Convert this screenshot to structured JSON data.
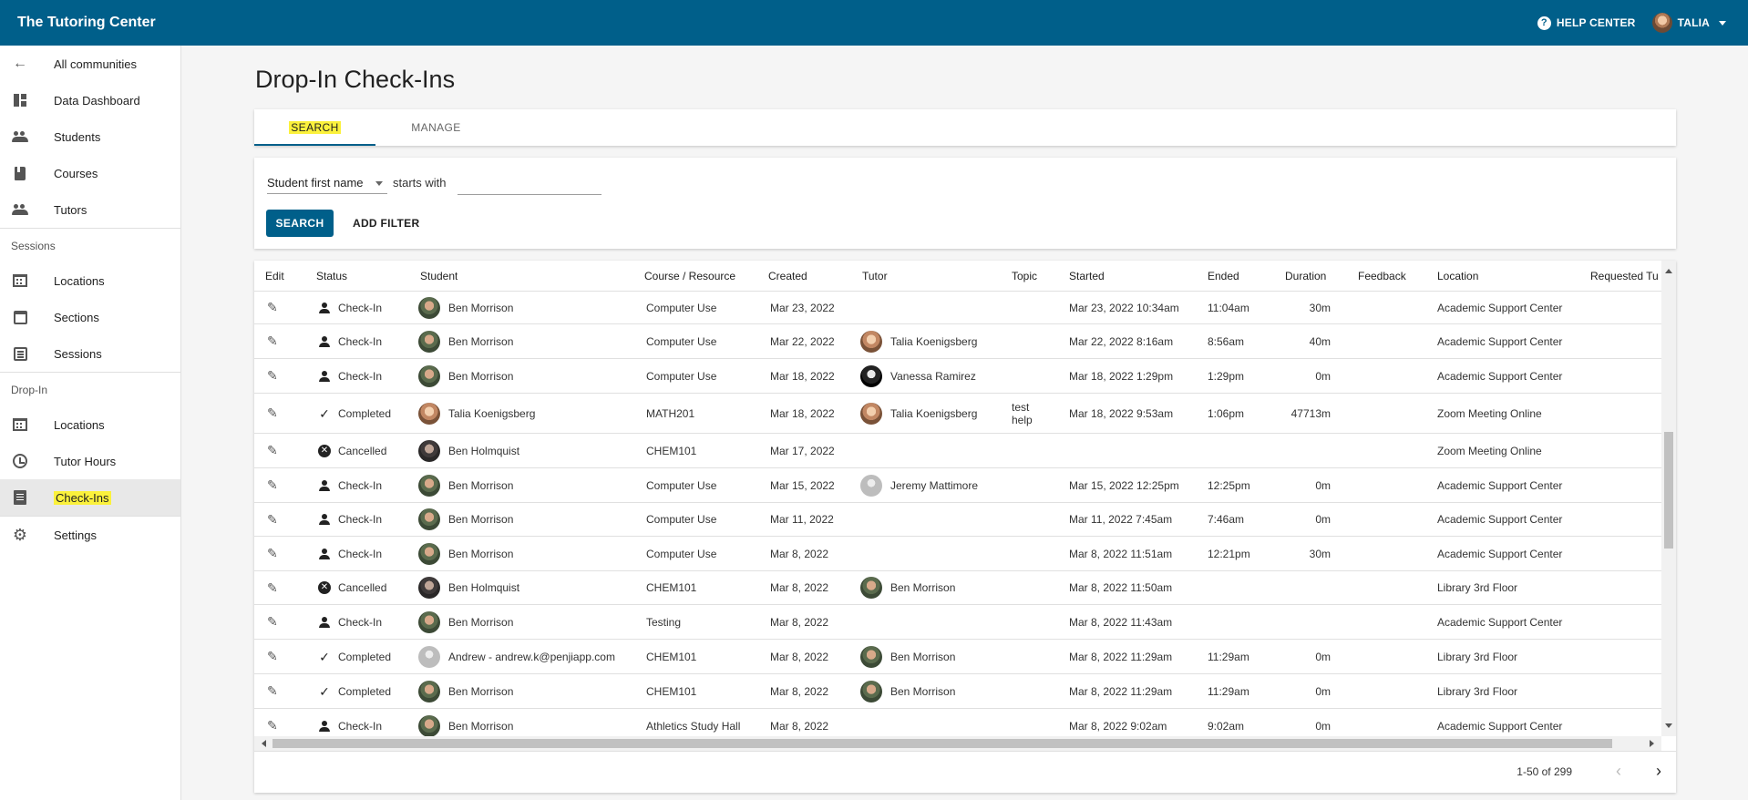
{
  "app": {
    "title": "The Tutoring Center",
    "help_label": "HELP CENTER",
    "user_name": "TALIA"
  },
  "sidebar": {
    "back": "All communities",
    "main_items": [
      "Data Dashboard",
      "Students",
      "Courses",
      "Tutors"
    ],
    "sessions_label": "Sessions",
    "sessions_items": [
      "Locations",
      "Sections",
      "Sessions"
    ],
    "dropin_label": "Drop-In",
    "dropin_items": [
      "Locations",
      "Tutor Hours",
      "Check-Ins"
    ],
    "settings": "Settings"
  },
  "page": {
    "title": "Drop-In Check-Ins"
  },
  "tabs": [
    {
      "label": "SEARCH"
    },
    {
      "label": "MANAGE"
    }
  ],
  "filter": {
    "field": "Student first name",
    "operator": "starts with",
    "value": "",
    "search_label": "SEARCH",
    "add_filter_label": "ADD FILTER"
  },
  "table": {
    "columns": [
      "Edit",
      "Status",
      "Student",
      "Course / Resource",
      "Created",
      "Tutor",
      "Topic",
      "Started",
      "Ended",
      "Duration",
      "Feedback",
      "Location",
      "Requested Tu"
    ],
    "rows": [
      {
        "status": "Check-In",
        "status_icon": "person-icon",
        "student": "Ben Morrison",
        "student_avatar": "ben",
        "course": "Computer Use",
        "created": "Mar 23, 2022",
        "tutor": "",
        "tutor_avatar": "",
        "topic": "",
        "started": "Mar 23, 2022 10:34am",
        "ended": "11:04am",
        "duration": "30m",
        "feedback": "",
        "location": "Academic Support Center"
      },
      {
        "status": "Check-In",
        "status_icon": "person-icon",
        "student": "Ben Morrison",
        "student_avatar": "ben",
        "course": "Computer Use",
        "created": "Mar 22, 2022",
        "tutor": "Talia Koenigsberg",
        "tutor_avatar": "talia",
        "topic": "",
        "started": "Mar 22, 2022 8:16am",
        "ended": "8:56am",
        "duration": "40m",
        "feedback": "",
        "location": "Academic Support Center"
      },
      {
        "status": "Check-In",
        "status_icon": "person-icon",
        "student": "Ben Morrison",
        "student_avatar": "ben",
        "course": "Computer Use",
        "created": "Mar 18, 2022",
        "tutor": "Vanessa Ramirez",
        "tutor_avatar": "vanessa",
        "topic": "",
        "started": "Mar 18, 2022 1:29pm",
        "ended": "1:29pm",
        "duration": "0m",
        "feedback": "",
        "location": "Academic Support Center"
      },
      {
        "status": "Completed",
        "status_icon": "check-icon",
        "student": "Talia Koenigsberg",
        "student_avatar": "talia",
        "course": "MATH201",
        "created": "Mar 18, 2022",
        "tutor": "Talia Koenigsberg",
        "tutor_avatar": "talia",
        "topic": "test help",
        "started": "Mar 18, 2022 9:53am",
        "ended": "1:06pm",
        "duration": "47713m",
        "feedback": "",
        "location": "Zoom Meeting Online"
      },
      {
        "status": "Cancelled",
        "status_icon": "cancel-icon",
        "student": "Ben Holmquist",
        "student_avatar": "holm",
        "course": "CHEM101",
        "created": "Mar 17, 2022",
        "tutor": "",
        "tutor_avatar": "",
        "topic": "",
        "started": "",
        "ended": "",
        "duration": "",
        "feedback": "",
        "location": "Zoom Meeting Online"
      },
      {
        "status": "Check-In",
        "status_icon": "person-icon",
        "student": "Ben Morrison",
        "student_avatar": "ben",
        "course": "Computer Use",
        "created": "Mar 15, 2022",
        "tutor": "Jeremy Mattimore",
        "tutor_avatar": "blank",
        "topic": "",
        "started": "Mar 15, 2022 12:25pm",
        "ended": "12:25pm",
        "duration": "0m",
        "feedback": "",
        "location": "Academic Support Center"
      },
      {
        "status": "Check-In",
        "status_icon": "person-icon",
        "student": "Ben Morrison",
        "student_avatar": "ben",
        "course": "Computer Use",
        "created": "Mar 11, 2022",
        "tutor": "",
        "tutor_avatar": "",
        "topic": "",
        "started": "Mar 11, 2022 7:45am",
        "ended": "7:46am",
        "duration": "0m",
        "feedback": "",
        "location": "Academic Support Center"
      },
      {
        "status": "Check-In",
        "status_icon": "person-icon",
        "student": "Ben Morrison",
        "student_avatar": "ben",
        "course": "Computer Use",
        "created": "Mar 8, 2022",
        "tutor": "",
        "tutor_avatar": "",
        "topic": "",
        "started": "Mar 8, 2022 11:51am",
        "ended": "12:21pm",
        "duration": "30m",
        "feedback": "",
        "location": "Academic Support Center"
      },
      {
        "status": "Cancelled",
        "status_icon": "cancel-icon",
        "student": "Ben Holmquist",
        "student_avatar": "holm",
        "course": "CHEM101",
        "created": "Mar 8, 2022",
        "tutor": "Ben Morrison",
        "tutor_avatar": "ben",
        "topic": "",
        "started": "Mar 8, 2022 11:50am",
        "ended": "",
        "duration": "",
        "feedback": "",
        "location": "Library 3rd Floor"
      },
      {
        "status": "Check-In",
        "status_icon": "person-icon",
        "student": "Ben Morrison",
        "student_avatar": "ben",
        "course": "Testing",
        "created": "Mar 8, 2022",
        "tutor": "",
        "tutor_avatar": "",
        "topic": "",
        "started": "Mar 8, 2022 11:43am",
        "ended": "",
        "duration": "",
        "feedback": "",
        "location": "Academic Support Center"
      },
      {
        "status": "Completed",
        "status_icon": "check-icon",
        "student": "Andrew - andrew.k@penjiapp.com",
        "student_avatar": "blank",
        "course": "CHEM101",
        "created": "Mar 8, 2022",
        "tutor": "Ben Morrison",
        "tutor_avatar": "ben",
        "topic": "",
        "started": "Mar 8, 2022 11:29am",
        "ended": "11:29am",
        "duration": "0m",
        "feedback": "",
        "location": "Library 3rd Floor"
      },
      {
        "status": "Completed",
        "status_icon": "check-icon",
        "student": "Ben Morrison",
        "student_avatar": "ben",
        "course": "CHEM101",
        "created": "Mar 8, 2022",
        "tutor": "Ben Morrison",
        "tutor_avatar": "ben",
        "topic": "",
        "started": "Mar 8, 2022 11:29am",
        "ended": "11:29am",
        "duration": "0m",
        "feedback": "",
        "location": "Library 3rd Floor"
      },
      {
        "status": "Check-In",
        "status_icon": "person-icon",
        "student": "Ben Morrison",
        "student_avatar": "ben",
        "course": "Athletics Study Hall",
        "created": "Mar 8, 2022",
        "tutor": "",
        "tutor_avatar": "",
        "topic": "",
        "started": "Mar 8, 2022 9:02am",
        "ended": "9:02am",
        "duration": "0m",
        "feedback": "",
        "location": "Academic Support Center"
      }
    ]
  },
  "pagination": {
    "range": "1-50 of 299"
  },
  "colors": {
    "primary": "#005f8a",
    "highlight": "#fbf13c"
  }
}
